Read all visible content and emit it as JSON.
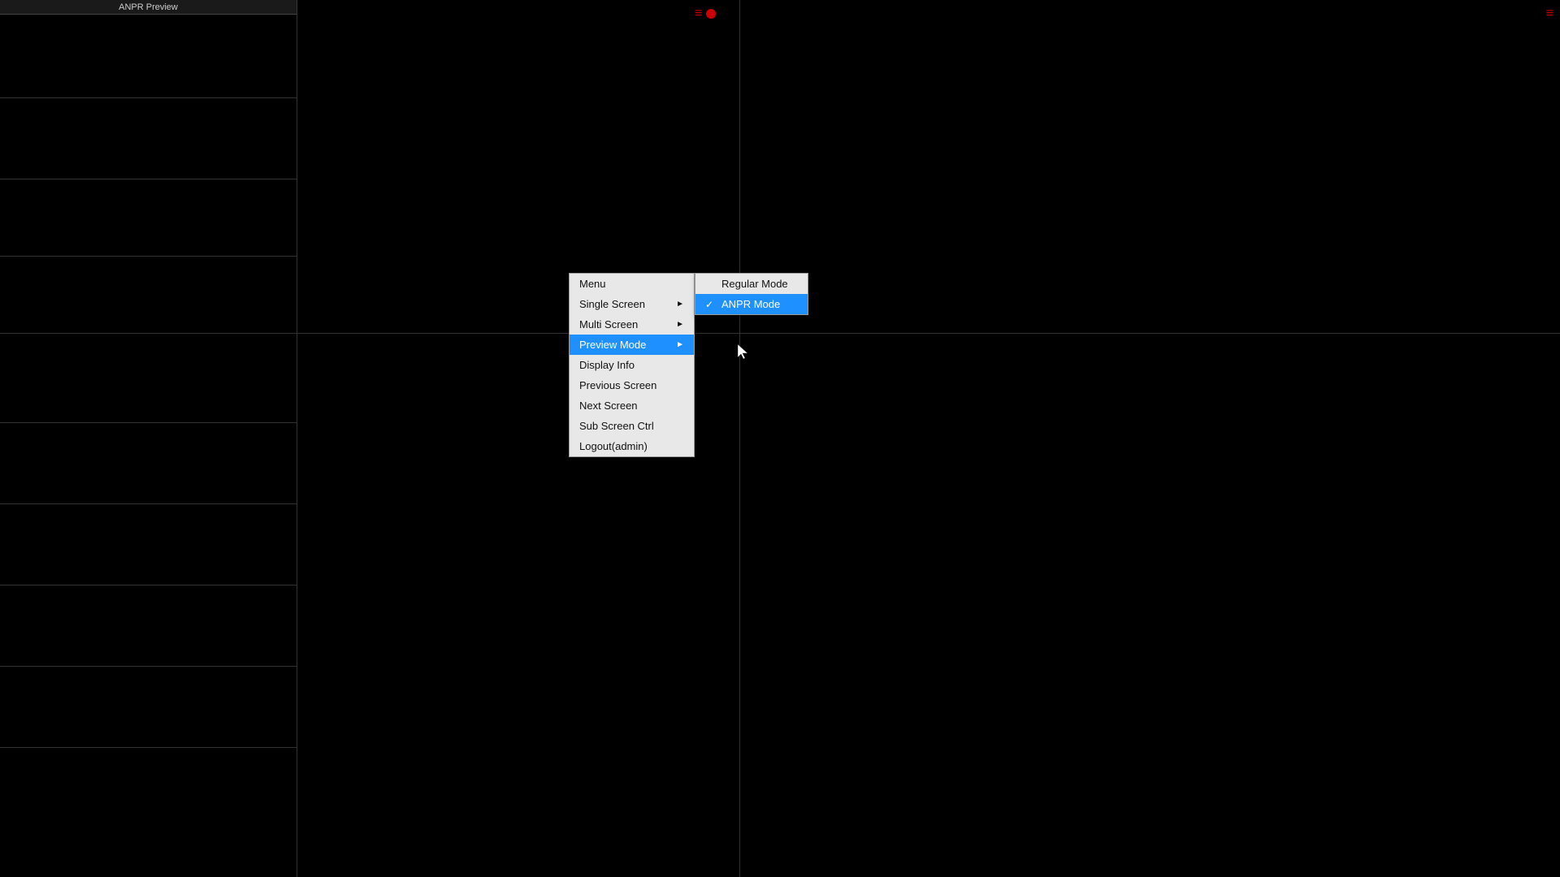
{
  "app": {
    "title": "ANPR Preview"
  },
  "icons": {
    "top_center_icon": "≡●",
    "top_right_icon": "≡"
  },
  "context_menu": {
    "items": [
      {
        "id": "menu",
        "label": "Menu",
        "has_arrow": false,
        "highlighted": false
      },
      {
        "id": "single-screen",
        "label": "Single Screen",
        "has_arrow": true,
        "highlighted": false
      },
      {
        "id": "multi-screen",
        "label": "Multi Screen",
        "has_arrow": true,
        "highlighted": false
      },
      {
        "id": "preview-mode",
        "label": "Preview Mode",
        "has_arrow": true,
        "highlighted": true
      },
      {
        "id": "display-info",
        "label": "Display Info",
        "has_arrow": false,
        "highlighted": false
      },
      {
        "id": "previous-screen",
        "label": "Previous Screen",
        "has_arrow": false,
        "highlighted": false
      },
      {
        "id": "next-screen",
        "label": "Next Screen",
        "has_arrow": false,
        "highlighted": false
      },
      {
        "id": "sub-screen-ctrl",
        "label": "Sub Screen Ctrl",
        "has_arrow": false,
        "highlighted": false
      },
      {
        "id": "logout",
        "label": "Logout(admin)",
        "has_arrow": false,
        "highlighted": false
      }
    ]
  },
  "submenu": {
    "items": [
      {
        "id": "regular-mode",
        "label": "Regular Mode",
        "checked": false,
        "active": false
      },
      {
        "id": "anpr-mode",
        "label": "ANPR Mode",
        "checked": true,
        "active": true
      }
    ]
  },
  "grid": {
    "left_panel_lines": [
      18,
      120,
      220,
      315,
      410,
      520,
      620,
      720
    ]
  }
}
